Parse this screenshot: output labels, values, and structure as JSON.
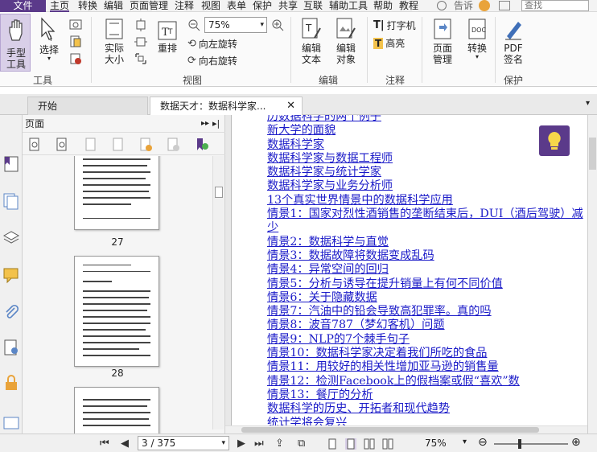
{
  "menubar": {
    "file": "文件",
    "tabs": [
      "主页",
      "转换",
      "编辑",
      "页面管理",
      "注释",
      "视图",
      "表单",
      "保护",
      "共享",
      "互联",
      "辅助工具",
      "帮助",
      "教程"
    ],
    "active_tab": "主页",
    "tell_me": "告诉",
    "search_placeholder": "查找"
  },
  "ribbon": {
    "hand_tool": "手型\n工具",
    "select": "选择",
    "tools_group": "工具",
    "actual_size": "实际\n大小",
    "reflow": "重排",
    "zoom_value": "75%",
    "rotate_left": "向左旋转",
    "rotate_right": "向右旋转",
    "view_group": "视图",
    "edit_text": "编辑\n文本",
    "edit_object": "编辑\n对象",
    "edit_group": "编辑",
    "typewriter": "打字机",
    "highlight": "高亮",
    "comment_group": "注释",
    "page_manage": "页面\n管理",
    "convert": "转换",
    "pdf_sign": "PDF\n签名",
    "protect_group": "保护"
  },
  "tabs": {
    "start": "开始",
    "document": "数据天才：数据科学家..."
  },
  "panel": {
    "title": "页面",
    "pages": [
      "27",
      "28"
    ]
  },
  "doc": {
    "links": [
      "历数据科学的两个例子",
      "新大学的面貌",
      "数据科学家",
      "数据科学家与数据工程师",
      "数据科学家与统计学家",
      "数据科学家与业务分析师",
      "13个真实世界情景中的数据科学应用",
      "情景1：国家对烈性酒销售的垄断结束后，DUI（酒后驾驶）减",
      "少",
      "情景2：数据科学与直觉",
      "情景3：数据故障将数据变成乱码",
      "情景4：异常空间的回归",
      "情景5：分析与诱导在提升销量上有何不同价值",
      "情景6：关于隐藏数据",
      "情景7：汽油中的铅会导致高犯罪率。真的吗",
      "情景8：波音787（梦幻客机）问题",
      "情景9：NLP的7个棘手句子",
      "情景10：数据科学家决定着我们所吃的食品",
      "情景11：用较好的相关性增加亚马逊的销售量",
      "情景12：检测Facebook上的假档案或假“喜欢”数",
      "情景13：餐厅的分析",
      "数据科学的历史、开拓者和现代趋势",
      "统计学将会复兴"
    ]
  },
  "status": {
    "page": "3 / 375",
    "zoom": "75%"
  },
  "colors": {
    "accent": "#5b3a8a",
    "link": "#1a1ac8"
  }
}
